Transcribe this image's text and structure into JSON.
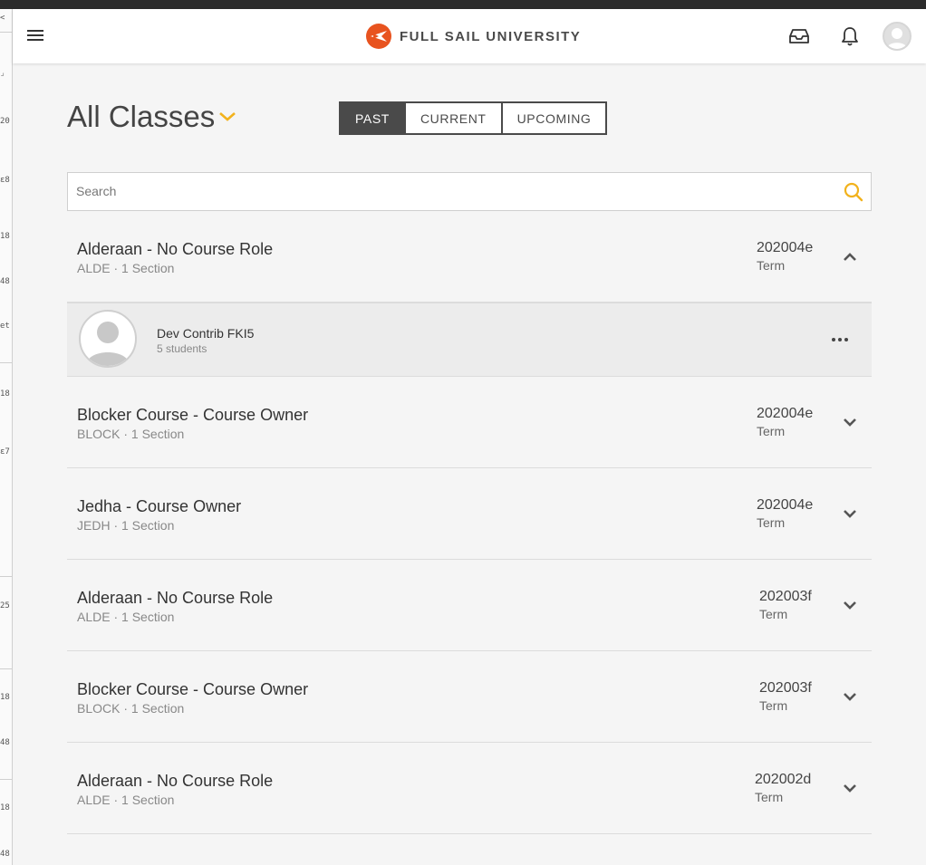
{
  "header": {
    "brand_name": "FULL SAIL UNIVERSITY",
    "brand_color": "#e8531f",
    "icons": [
      "menu-icon",
      "inbox-icon",
      "bell-icon",
      "user-avatar"
    ]
  },
  "gutter": {
    "marks": [
      "<",
      "⌟",
      "20",
      "ε8",
      "18",
      "48",
      "et",
      "18",
      "ε7",
      "25",
      "18",
      "48",
      "18",
      "48"
    ]
  },
  "page": {
    "title": "All Classes",
    "accent_color": "#f2b21c"
  },
  "filter_tabs": [
    {
      "label": "PAST",
      "active": true
    },
    {
      "label": "CURRENT",
      "active": false
    },
    {
      "label": "UPCOMING",
      "active": false
    }
  ],
  "search": {
    "placeholder": "Search",
    "value": ""
  },
  "courses": [
    {
      "name": "Alderaan - No Course Role",
      "code": "ALDE · 1 Section",
      "term": "202004e",
      "term_label": "Term",
      "expanded": true
    },
    {
      "name": "Blocker Course - Course Owner",
      "code": "BLOCK · 1 Section",
      "term": "202004e",
      "term_label": "Term",
      "expanded": false
    },
    {
      "name": "Jedha - Course Owner",
      "code": "JEDH · 1 Section",
      "term": "202004e",
      "term_label": "Term",
      "expanded": false
    },
    {
      "name": "Alderaan - No Course Role",
      "code": "ALDE · 1 Section",
      "term": "202003f",
      "term_label": "Term",
      "expanded": false
    },
    {
      "name": "Blocker Course - Course Owner",
      "code": "BLOCK · 1 Section",
      "term": "202003f",
      "term_label": "Term",
      "expanded": false
    },
    {
      "name": "Alderaan - No Course Role",
      "code": "ALDE · 1 Section",
      "term": "202002d",
      "term_label": "Term",
      "expanded": false
    }
  ],
  "expanded_section": {
    "name": "Dev Contrib FKI5",
    "students": "5 students"
  }
}
